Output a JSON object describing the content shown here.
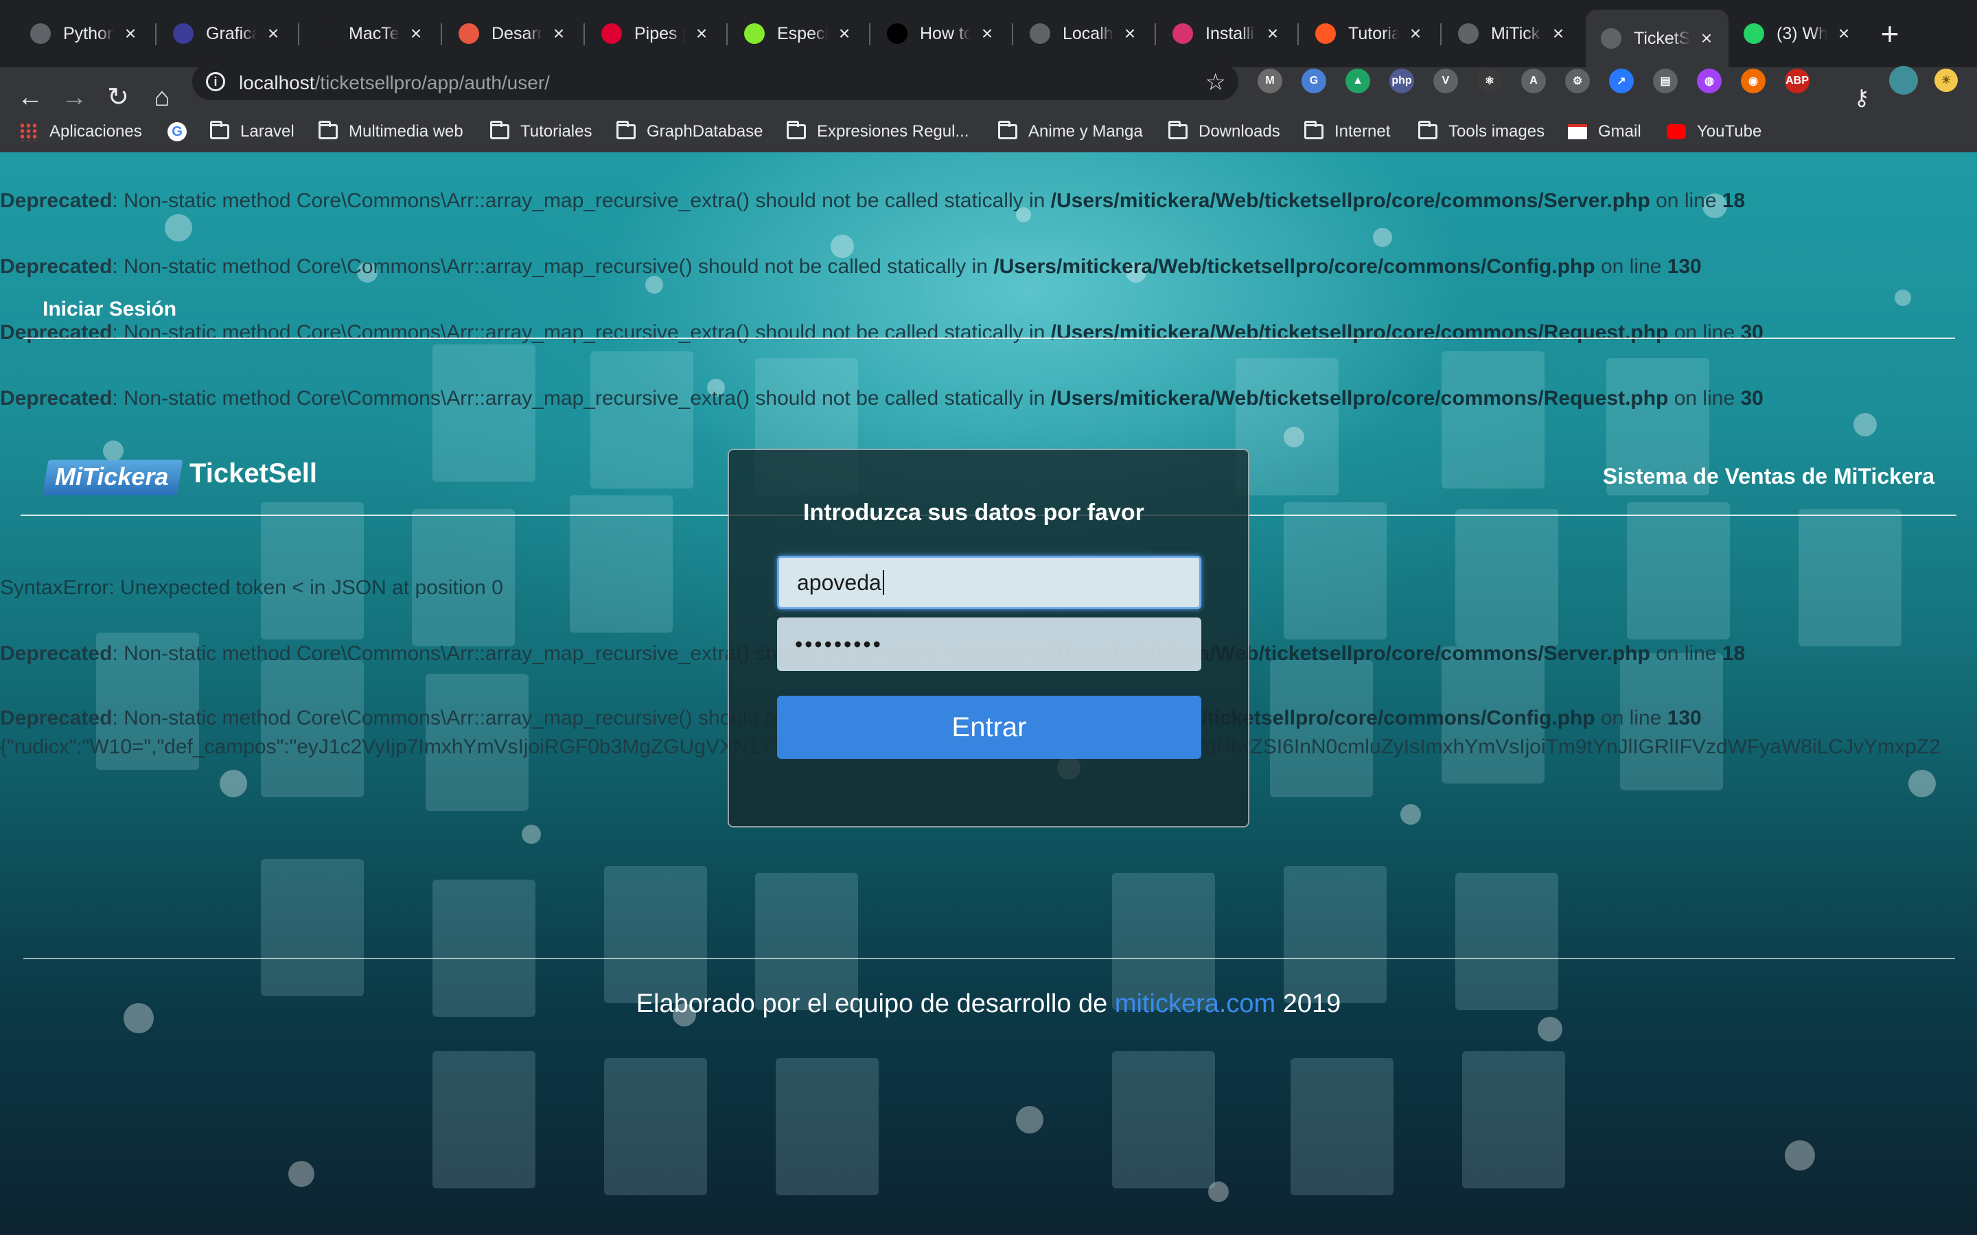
{
  "tabs": [
    {
      "title": "Python",
      "favicon_color": "#5f6368",
      "icon": "globe-icon"
    },
    {
      "title": "Grafica",
      "favicon_color": "#3b3b98",
      "icon": "ufo-icon"
    },
    {
      "title": "MacTeX",
      "favicon_color": "#202124",
      "icon": "blank-icon"
    },
    {
      "title": "Desarro",
      "favicon_color": "#e8573f",
      "icon": "hexagon-icon"
    },
    {
      "title": "Pipes |",
      "favicon_color": "#dd0031",
      "icon": "bird-icon"
    },
    {
      "title": "Especif",
      "favicon_color": "#85ea2d",
      "icon": "swagger-icon"
    },
    {
      "title": "How to",
      "favicon_color": "#000000",
      "icon": "medium-icon"
    },
    {
      "title": "Localh",
      "favicon_color": "#5f6368",
      "icon": "github-icon"
    },
    {
      "title": "Installi",
      "favicon_color": "#d6336c",
      "icon": "zend-icon"
    },
    {
      "title": "Tutoria",
      "favicon_color": "#ff5722",
      "icon": "flame-icon"
    },
    {
      "title": "MiTick",
      "favicon_color": "#5f6368",
      "icon": "globe-icon"
    },
    {
      "title": "TicketS",
      "favicon_color": "#5f6368",
      "icon": "globe-icon"
    },
    {
      "title": "(3) Wh",
      "favicon_color": "#25d366",
      "icon": "whatsapp-icon"
    }
  ],
  "address_bar": {
    "host": "localhost",
    "path": "/ticketsellpro/app/auth/user/"
  },
  "bookmarks": [
    {
      "label": "Aplicaciones",
      "icon": "apps-grid-icon"
    },
    {
      "label": "",
      "icon": "google-icon"
    },
    {
      "label": "Laravel",
      "icon": "folder-icon"
    },
    {
      "label": "Multimedia web",
      "icon": "folder-icon"
    },
    {
      "label": "Tutoriales",
      "icon": "folder-icon"
    },
    {
      "label": "GraphDatabase",
      "icon": "folder-icon"
    },
    {
      "label": "Expresiones Regul...",
      "icon": "folder-icon"
    },
    {
      "label": "Anime y Manga",
      "icon": "folder-icon"
    },
    {
      "label": "Downloads",
      "icon": "folder-icon"
    },
    {
      "label": "Internet",
      "icon": "folder-icon"
    },
    {
      "label": "Tools images",
      "icon": "folder-icon"
    },
    {
      "label": "Gmail",
      "icon": "gmail-icon"
    },
    {
      "label": "YouTube",
      "icon": "youtube-icon"
    }
  ],
  "extensions": [
    {
      "label": "M",
      "color": "#6b6b6b"
    },
    {
      "label": "G",
      "color": "#4a7fd4"
    },
    {
      "label": "▲",
      "color": "#1fa463"
    },
    {
      "label": "php",
      "color": "#4f5b93"
    },
    {
      "label": "V",
      "color": "#5f6368"
    },
    {
      "label": "⚛",
      "color": "#3a3a3a"
    },
    {
      "label": "A",
      "color": "#5f6368"
    },
    {
      "label": "⚙",
      "color": "#5f6368"
    },
    {
      "label": "↗",
      "color": "#2979ff"
    },
    {
      "label": "▤",
      "color": "#5f6368"
    },
    {
      "label": "◍",
      "color": "#a142f4"
    },
    {
      "label": "◉",
      "color": "#ef6c00"
    },
    {
      "label": "ABP",
      "color": "#c8241a"
    }
  ],
  "errors": {
    "e1": {
      "label": "Deprecated",
      "text": ": Non-static method Core\\Commons\\Arr::array_map_recursive_extra() should not be called statically in ",
      "path": "/Users/mitickera/Web/ticketsellpro/core/commons/Server.php",
      "online": " on line ",
      "line": "18"
    },
    "e2": {
      "label": "Deprecated",
      "text": ": Non-static method Core\\Commons\\Arr::array_map_recursive() should not be called statically in ",
      "path": "/Users/mitickera/Web/ticketsellpro/core/commons/Config.php",
      "online": " on line ",
      "line": "130"
    },
    "e3": {
      "label": "Deprecated",
      "text": ": Non-static method Core\\Commons\\Arr::array_map_recursive_extra() should not be called statically in ",
      "path": "/Users/mitickera/Web/ticketsellpro/core/commons/Request.php",
      "online": " on line ",
      "line": "30"
    },
    "e4": {
      "label": "Deprecated",
      "text": ": Non-static method Core\\Commons\\Arr::array_map_recursive_extra() should not be called statically in ",
      "path": "/Users/mitickera/Web/ticketsellpro/core/commons/Request.php",
      "online": " on line ",
      "line": "30"
    },
    "syntax": "SyntaxError: Unexpected token < in JSON at position 0",
    "e5": {
      "label": "Deprecated",
      "text": ": Non-static method Core\\Commons\\Arr::array_map_recursive_extra() should not be called statically in ",
      "path": "/Users/mitickera/Web/ticketsellpro/core/commons/Server.php",
      "online": " on line ",
      "line": "18"
    },
    "e6": {
      "label": "Deprecated",
      "text": ": Non-static method Core\\Commons\\Arr::array_map_recursive() should not be called statically in ",
      "path": "/Users/mitickera/Web/ticketsellpro/core/commons/Config.php",
      "online": " on line ",
      "line": "130"
    },
    "json": "{\"rudicx\":\"W10=\",\"def_campos\":\"eyJ1c2VyIjp7ImxhYmVsIjoiRGF0b3MgZGUgVXN1YXJpbyIsImZpZWxkcyI6eyJuYW1lIjp7ImRhdGFfdHlwZSI6InN0cmluZyIsImxhYmVsIjoiTm9tYnJlIGRlIFVzdWFyaW8iLCJvYmxpZ2"
  },
  "page": {
    "login_title": "Iniciar Sesión",
    "logo_text": "MiTickera",
    "brand": "TicketSell",
    "system_title": "Sistema de Ventas de MiTickera",
    "modal_title": "Introduzca sus datos por favor",
    "username_value": "apoveda",
    "password_value": "•••••••••",
    "submit_label": "Entrar",
    "footer_prefix": "Elaborado por el equipo de desarrollo de ",
    "footer_link": "mitickera.com",
    "footer_suffix": " 2019"
  }
}
